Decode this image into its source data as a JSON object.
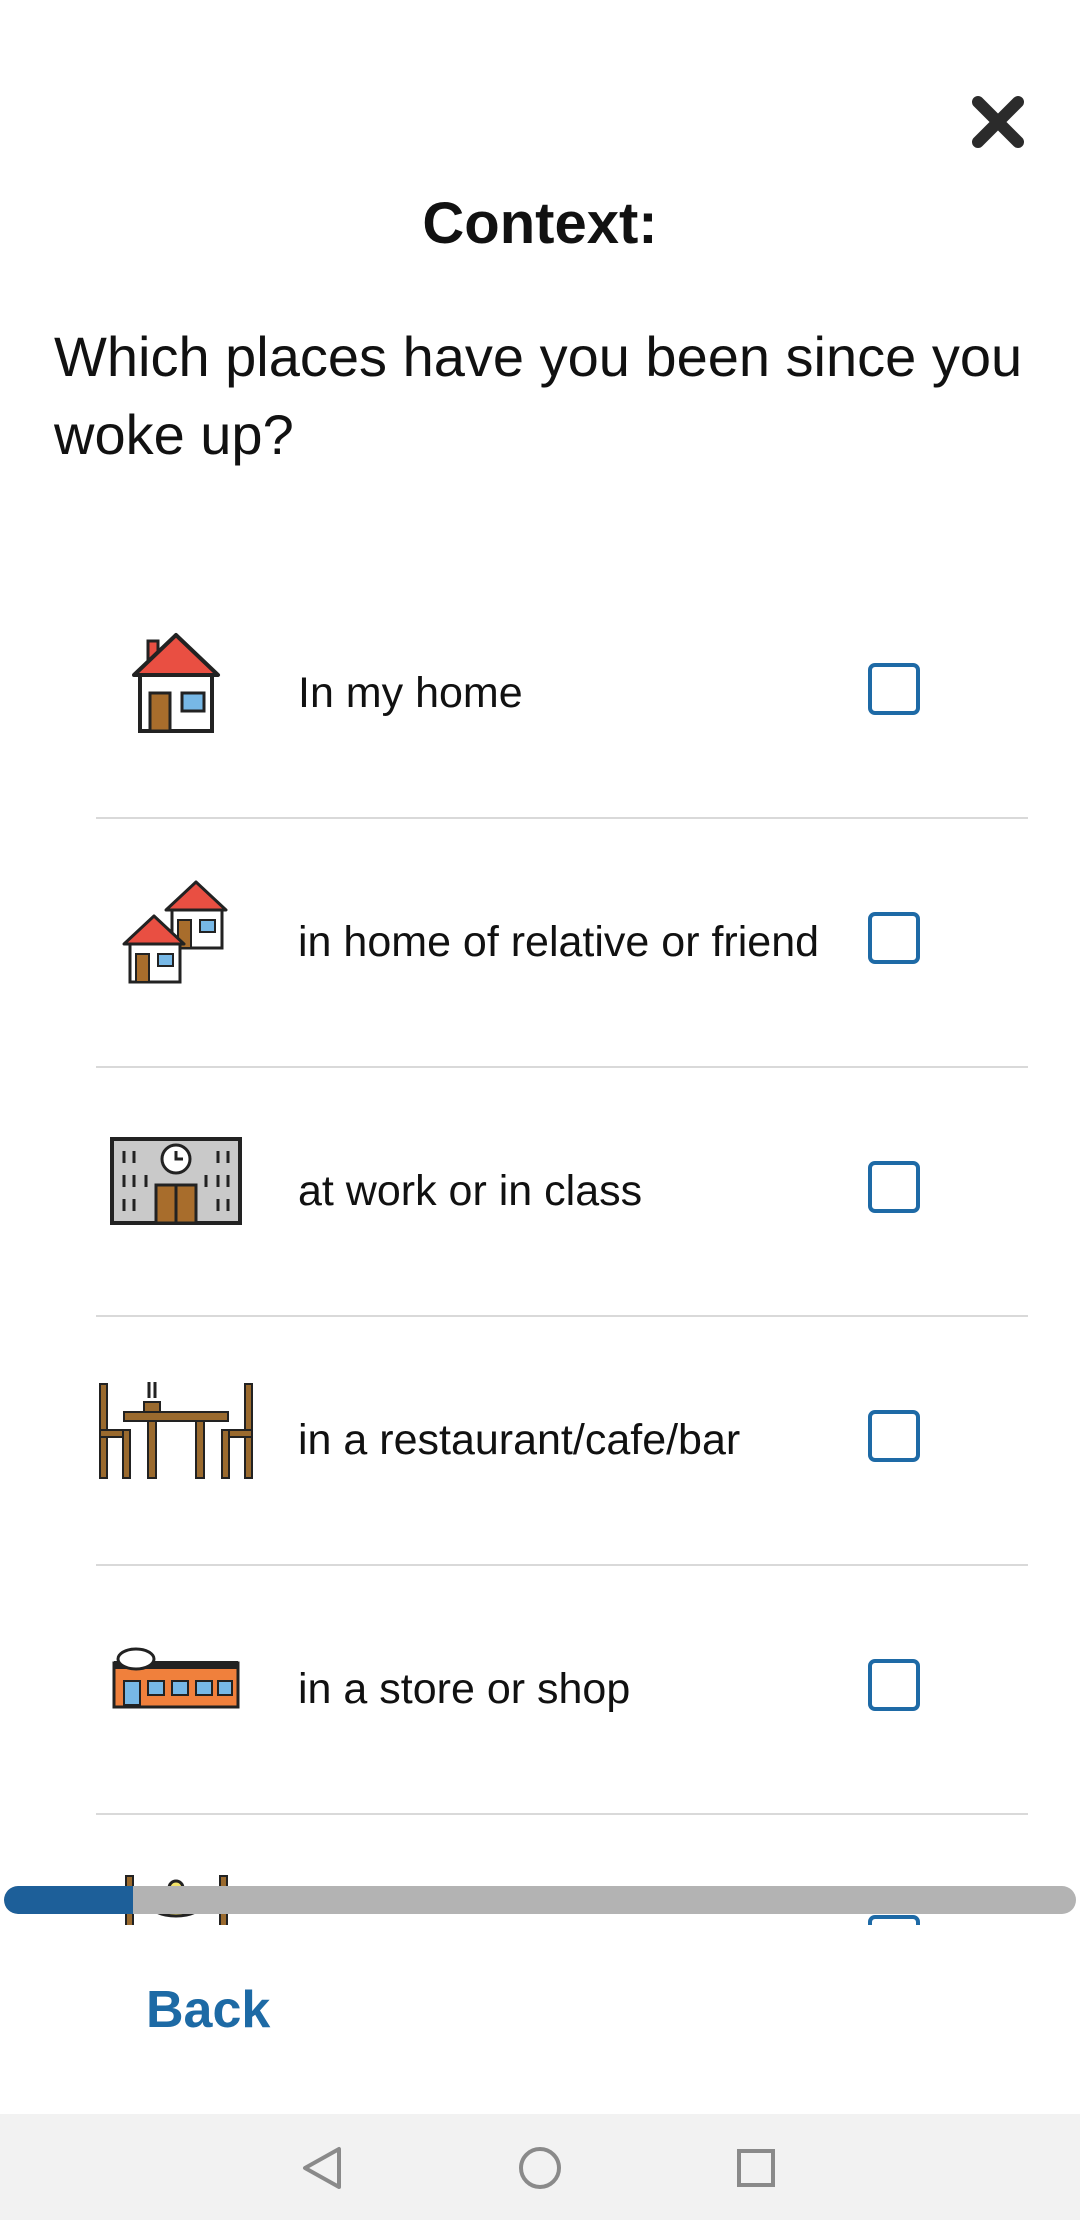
{
  "header": {
    "title": "Context:",
    "close_icon": "close-icon"
  },
  "question": "Which places have you been since you woke up?",
  "options": [
    {
      "label": "In my home",
      "icon": "home-icon",
      "checked": false
    },
    {
      "label": "in home of relative or friend",
      "icon": "two-houses-icon",
      "checked": false
    },
    {
      "label": "at work or in class",
      "icon": "office-building-icon",
      "checked": false
    },
    {
      "label": "in a restaurant/cafe/bar",
      "icon": "restaurant-table-icon",
      "checked": false
    },
    {
      "label": "in a store or shop",
      "icon": "store-icon",
      "checked": false
    }
  ],
  "progress": {
    "value": 0.12,
    "fill_color": "#1d5f99",
    "track_color": "#b3b3b3"
  },
  "footer": {
    "back_label": "Back"
  },
  "colors": {
    "accent": "#1d6aa5",
    "checkbox_border": "#1e6aa6"
  }
}
